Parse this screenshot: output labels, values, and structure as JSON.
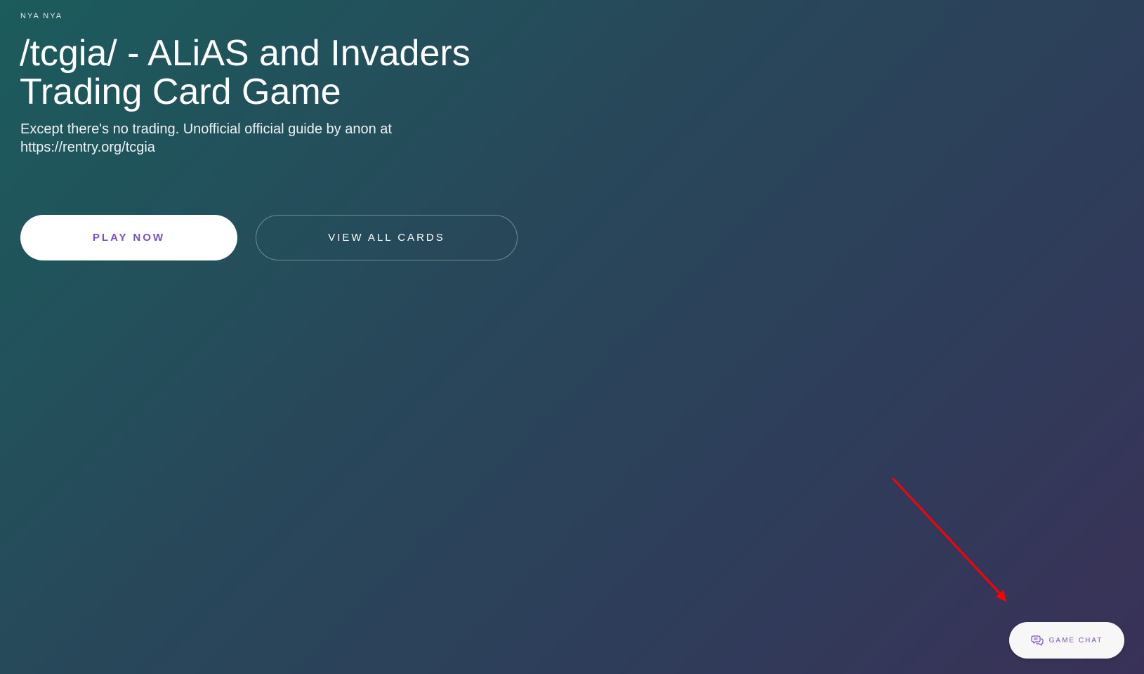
{
  "header": {
    "eyebrow": "NYA NYA",
    "title": "/tcgia/ - ALiAS and Invaders Trading Card Game",
    "subtitle": "Except there's no trading. Unofficial official guide by anon at https://rentry.org/tcgia"
  },
  "actions": {
    "play_label": "PLAY NOW",
    "view_cards_label": "VIEW ALL CARDS"
  },
  "chat": {
    "label": "GAME CHAT",
    "icon": "chat-bubbles-icon"
  },
  "annotation": {
    "icon": "red-arrow"
  },
  "colors": {
    "accent": "#7a4fc6",
    "arrow": "#ff0000",
    "gradient_start": "#1b5c5c",
    "gradient_end": "#3a3158"
  }
}
